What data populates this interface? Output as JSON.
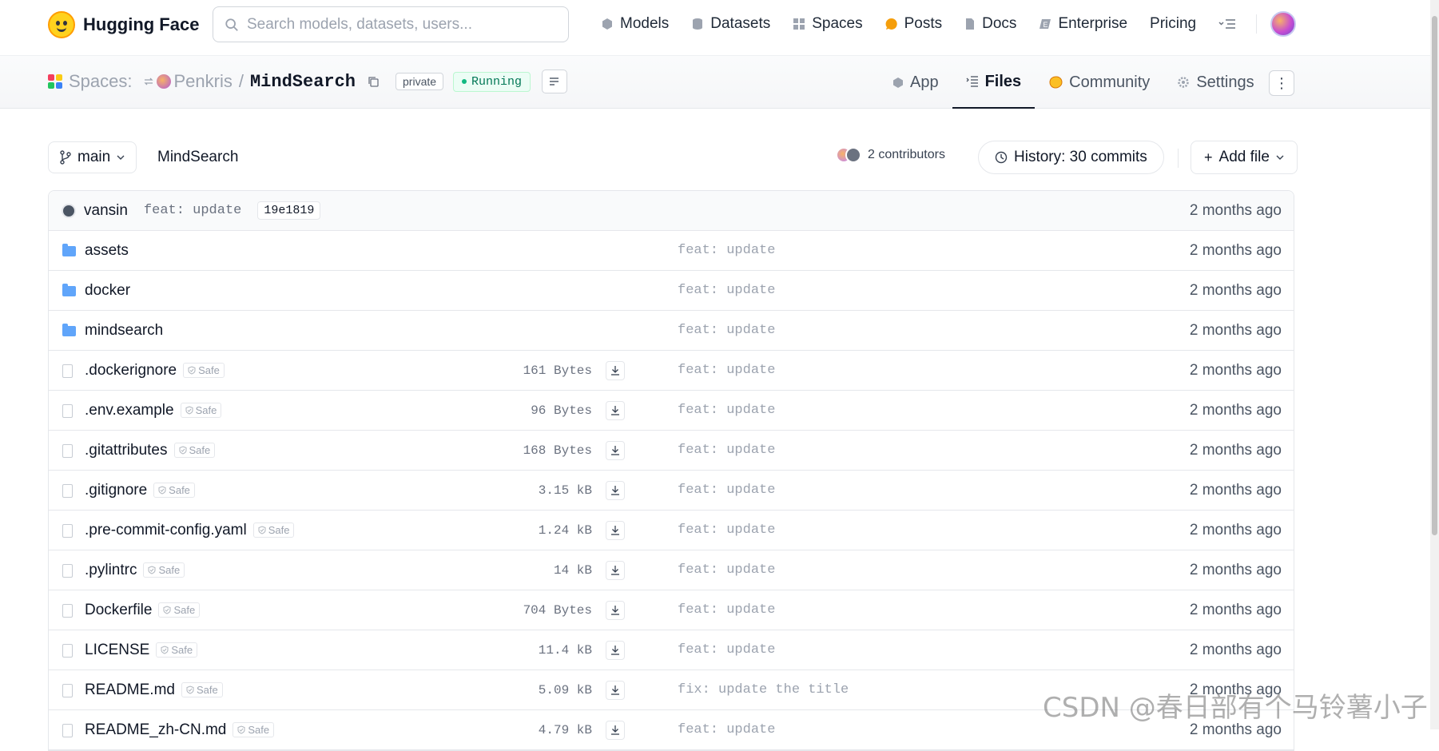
{
  "brand": {
    "name": "Hugging Face"
  },
  "search": {
    "placeholder": "Search models, datasets, users..."
  },
  "nav": {
    "items": [
      {
        "label": "Models",
        "icon": "models-icon"
      },
      {
        "label": "Datasets",
        "icon": "datasets-icon"
      },
      {
        "label": "Spaces",
        "icon": "spaces-icon"
      },
      {
        "label": "Posts",
        "icon": "posts-icon"
      },
      {
        "label": "Docs",
        "icon": "docs-icon"
      },
      {
        "label": "Enterprise",
        "icon": "enterprise-icon"
      },
      {
        "label": "Pricing",
        "icon": ""
      }
    ]
  },
  "space": {
    "section_label": "Spaces:",
    "owner": "Penkris",
    "separator": "/",
    "repo": "MindSearch",
    "visibility": "private",
    "status": "Running",
    "tabs": [
      {
        "label": "App",
        "icon": "app-icon"
      },
      {
        "label": "Files",
        "icon": "files-icon",
        "active": true
      },
      {
        "label": "Community",
        "icon": "community-icon"
      },
      {
        "label": "Settings",
        "icon": "settings-icon"
      }
    ]
  },
  "branch": {
    "name": "main",
    "path": "MindSearch"
  },
  "contributors": {
    "label": "2 contributors"
  },
  "history": {
    "label": "History: 30 commits"
  },
  "add_file": {
    "label": "Add file"
  },
  "last_commit": {
    "author": "vansin",
    "message": "feat: update",
    "hash": "19e1819",
    "time": "2 months ago"
  },
  "files": [
    {
      "name": "assets",
      "type": "folder",
      "size": "",
      "message": "feat: update",
      "time": "2 months ago",
      "safe": ""
    },
    {
      "name": "docker",
      "type": "folder",
      "size": "",
      "message": "feat: update",
      "time": "2 months ago",
      "safe": ""
    },
    {
      "name": "mindsearch",
      "type": "folder",
      "size": "",
      "message": "feat: update",
      "time": "2 months ago",
      "safe": ""
    },
    {
      "name": ".dockerignore",
      "type": "file",
      "size": "161 Bytes",
      "message": "feat: update",
      "time": "2 months ago",
      "safe": "Safe"
    },
    {
      "name": ".env.example",
      "type": "file",
      "size": "96 Bytes",
      "message": "feat: update",
      "time": "2 months ago",
      "safe": "Safe"
    },
    {
      "name": ".gitattributes",
      "type": "file",
      "size": "168 Bytes",
      "message": "feat: update",
      "time": "2 months ago",
      "safe": "Safe"
    },
    {
      "name": ".gitignore",
      "type": "file",
      "size": "3.15 kB",
      "message": "feat: update",
      "time": "2 months ago",
      "safe": "Safe"
    },
    {
      "name": ".pre-commit-config.yaml",
      "type": "file",
      "size": "1.24 kB",
      "message": "feat: update",
      "time": "2 months ago",
      "safe": "Safe"
    },
    {
      "name": ".pylintrc",
      "type": "file",
      "size": "14 kB",
      "message": "feat: update",
      "time": "2 months ago",
      "safe": "Safe"
    },
    {
      "name": "Dockerfile",
      "type": "file",
      "size": "704 Bytes",
      "message": "feat: update",
      "time": "2 months ago",
      "safe": "Safe"
    },
    {
      "name": "LICENSE",
      "type": "file",
      "size": "11.4 kB",
      "message": "feat: update",
      "time": "2 months ago",
      "safe": "Safe"
    },
    {
      "name": "README.md",
      "type": "file",
      "size": "5.09 kB",
      "message": "fix: update the title",
      "time": "2 months ago",
      "safe": "Safe"
    },
    {
      "name": "README_zh-CN.md",
      "type": "file",
      "size": "4.79 kB",
      "message": "feat: update",
      "time": "2 months ago",
      "safe": "Safe"
    }
  ],
  "watermark": "CSDN @春日部有个马铃薯小子"
}
